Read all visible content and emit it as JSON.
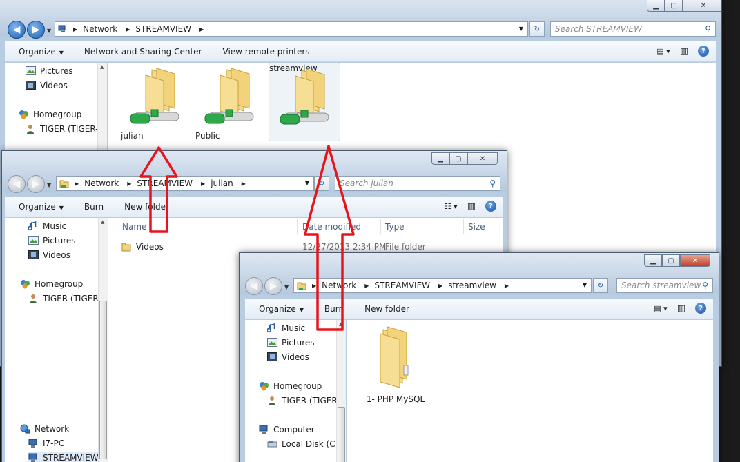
{
  "back_window": {
    "address": {
      "crumbs": [
        "Network",
        "STREAMVIEW"
      ]
    },
    "search_placeholder": "Search STREAMVIEW",
    "toolbar": {
      "organize": "Organize",
      "network_sharing": "Network and Sharing Center",
      "remote_printers": "View remote printers"
    },
    "tree": [
      {
        "label": "Pictures",
        "icon": "pictures-icon"
      },
      {
        "label": "Videos",
        "icon": "videos-icon"
      },
      {
        "label": "Homegroup",
        "icon": "homegroup-icon"
      },
      {
        "label": "TIGER (TIGER-P",
        "icon": "user-icon"
      }
    ],
    "shares": [
      {
        "label": "julian",
        "icon": "network-share-folder-icon"
      },
      {
        "label": "Public",
        "icon": "network-share-folder-icon"
      },
      {
        "label": "streamview",
        "icon": "network-share-folder-icon",
        "selected": true
      }
    ]
  },
  "julian_window": {
    "address": {
      "crumbs": [
        "Network",
        "STREAMVIEW",
        "julian"
      ]
    },
    "search_placeholder": "Search julian",
    "toolbar": {
      "organize": "Organize",
      "burn": "Burn",
      "new_folder": "New folder"
    },
    "tree": [
      {
        "label": "Music",
        "icon": "music-icon"
      },
      {
        "label": "Pictures",
        "icon": "pictures-icon"
      },
      {
        "label": "Videos",
        "icon": "videos-icon"
      },
      {
        "label": "Homegroup",
        "icon": "homegroup-icon"
      },
      {
        "label": "TIGER (TIGER-P",
        "icon": "user-icon"
      },
      {
        "label": "Network",
        "icon": "network-icon"
      },
      {
        "label": "I7-PC",
        "icon": "computer-icon"
      },
      {
        "label": "STREAMVIEW",
        "icon": "computer-icon"
      }
    ],
    "columns": {
      "name": "Name",
      "date": "Date modified",
      "type": "Type",
      "size": "Size"
    },
    "rows": [
      {
        "name": "Videos",
        "date": "12/27/2013 2:34 PM",
        "type": "File folder",
        "size": ""
      }
    ]
  },
  "streamview_window": {
    "address": {
      "crumbs": [
        "Network",
        "STREAMVIEW",
        "streamview"
      ]
    },
    "search_placeholder": "Search streamview",
    "toolbar": {
      "organize": "Organize",
      "burn": "Burn",
      "new_folder": "New folder"
    },
    "tree": [
      {
        "label": "Music",
        "icon": "music-icon"
      },
      {
        "label": "Pictures",
        "icon": "pictures-icon"
      },
      {
        "label": "Videos",
        "icon": "videos-icon"
      },
      {
        "label": "Homegroup",
        "icon": "homegroup-icon"
      },
      {
        "label": "TIGER (TIGER-P",
        "icon": "user-icon"
      },
      {
        "label": "Computer",
        "icon": "computer-icon"
      },
      {
        "label": "Local Disk (C:)",
        "icon": "local-disk-icon"
      }
    ],
    "items": [
      {
        "label": "1- PHP MySQL",
        "icon": "folder-icon"
      }
    ]
  },
  "colors": {
    "annotation_arrow": "#e8141c",
    "folder": "#f2d27a",
    "share_cable": "#2ea84a",
    "accent": "#1c5fb4"
  }
}
